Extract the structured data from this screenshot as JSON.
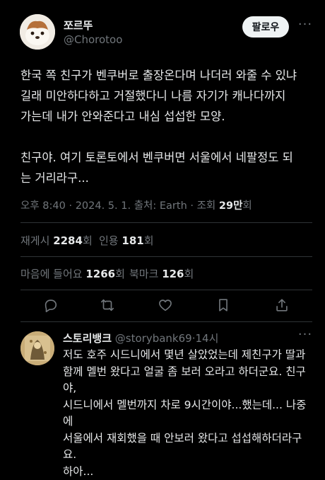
{
  "post": {
    "author_name": "쪼르뚜",
    "author_handle": "@Chorotoo",
    "follow_label": "팔로우",
    "more_label": "···",
    "paragraphs": [
      "한국 쪽 친구가 벤쿠버로 출장온다며 나더러 와줄 수 있냐\n길래 미안하다하고 거절했다니 나름 자기가 캐나다까지\n가는데 내가 안와준다고 내심 섭섭한 모양.",
      "친구야. 여기 토론토에서 벤쿠버면 서울에서 네팔정도 되\n는 거리라구..."
    ],
    "meta": {
      "time": "오후 8:40",
      "date": "2024. 5. 1.",
      "source": "출처: Earth",
      "views_label": "조회",
      "views_value": "29만",
      "views_unit": "회"
    },
    "stats": {
      "reposts_label": "재게시",
      "reposts_value": "2284",
      "reposts_unit": "회",
      "quotes_label": "인용",
      "quotes_value": "181",
      "quotes_unit": "회",
      "likes_label": "마음에 들어요",
      "likes_value": "1266",
      "likes_unit": "회",
      "bookmarks_label": "북마크",
      "bookmarks_value": "126",
      "bookmarks_unit": "회"
    },
    "actions": [
      "reply-icon",
      "repost-icon",
      "like-icon",
      "bookmark-icon",
      "share-icon"
    ]
  },
  "reply": {
    "author_name": "스토리뱅크",
    "author_handle": "@storybank69",
    "separator": "·",
    "time": "14시",
    "more_label": "···",
    "text": "저도 호주 시드니에서 몇년 살았었는데 제친구가 딸과\n함께 멜번 왔다고 얼굴 좀 보러 오라고 하더군요. 친구야,\n시드니에서 멜번까지 차로 9시간이야...했는데... 나중에\n서울에서 재회했을 때 안보러 왔다고 섭섭해하더라구요.\n하아..."
  },
  "colors": {
    "background": "#000000",
    "text_primary": "#e7e9ea",
    "text_secondary": "#71767b",
    "divider": "#2f3336",
    "follow_bg": "#eff3f4"
  }
}
